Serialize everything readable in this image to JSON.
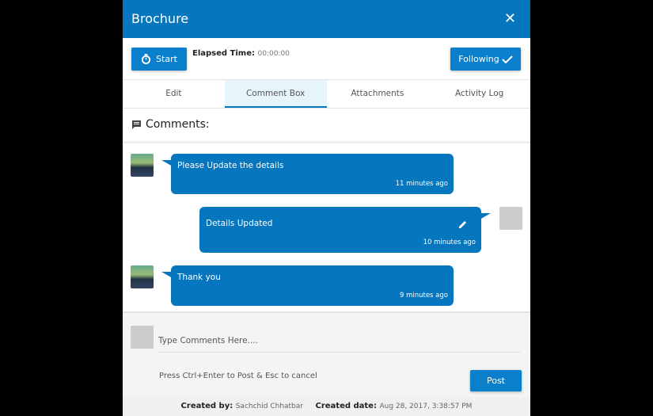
{
  "header": {
    "title": "Brochure",
    "close_icon": "close-icon"
  },
  "toolbar": {
    "start_label": "Start",
    "elapsed_label": "Elapsed Time:",
    "elapsed_value": "00:00:00",
    "following_label": "Following"
  },
  "tabs": [
    {
      "label": "Edit"
    },
    {
      "label": "Comment Box"
    },
    {
      "label": "Attachments"
    },
    {
      "label": "Activity Log"
    }
  ],
  "comments": {
    "heading": "Comments:",
    "items": [
      {
        "text": "Please Update the details",
        "time": "11 minutes ago"
      },
      {
        "text": "Details Updated",
        "time": "10 minutes ago"
      },
      {
        "text": "Thank you",
        "time": "9 minutes ago"
      }
    ]
  },
  "composer": {
    "placeholder": "Type Comments Here....",
    "hint": "Press Ctrl+Enter to Post & Esc to cancel",
    "post_label": "Post"
  },
  "footer": {
    "created_by_label": "Created by:",
    "created_by": "Sachchid Chhatbar",
    "created_date_label": "Created date:",
    "created_date": "Aug 28, 2017, 3:38:57 PM"
  },
  "colors": {
    "primary": "#0676bf"
  }
}
